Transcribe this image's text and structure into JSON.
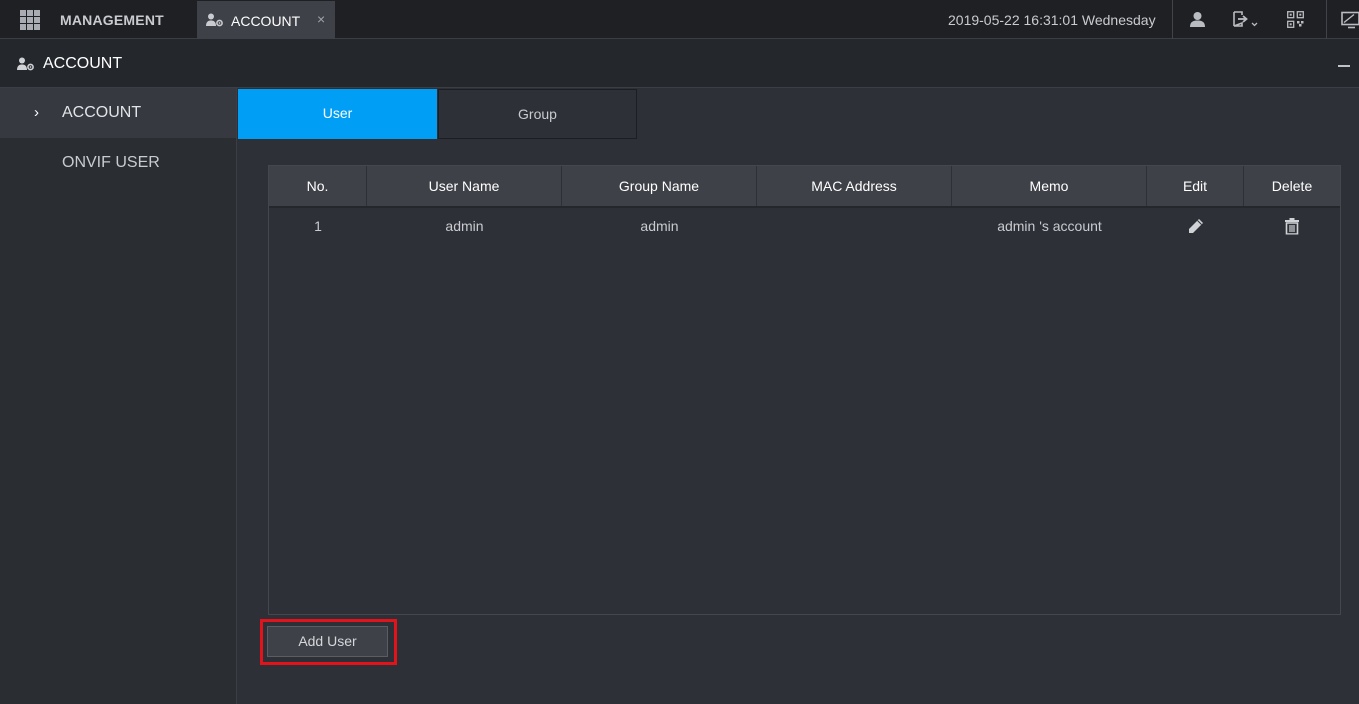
{
  "topbar": {
    "app_title": "MANAGEMENT",
    "tab_label": "ACCOUNT",
    "tab_close": "×",
    "datetime": "2019-05-22 16:31:01 Wednesday",
    "icons": [
      "apps-grid-icon",
      "user-icon",
      "logout-icon",
      "qr-code-icon",
      "monitor-icon"
    ]
  },
  "header": {
    "title": "ACCOUNT",
    "icon": "account-settings-icon"
  },
  "sidebar": {
    "items": [
      {
        "label": "ACCOUNT",
        "marker": "›",
        "active": true
      },
      {
        "label": "ONVIF USER",
        "active": false
      }
    ]
  },
  "subtabs": {
    "user": "User",
    "group": "Group"
  },
  "table": {
    "columns": [
      "No.",
      "User Name",
      "Group Name",
      "MAC Address",
      "Memo",
      "Edit",
      "Delete"
    ],
    "rows": [
      {
        "no": "1",
        "user_name": "admin",
        "group_name": "admin",
        "mac": "",
        "memo": "admin 's account"
      }
    ]
  },
  "actions": {
    "add_user": "Add User"
  },
  "colors": {
    "accent": "#009ef5",
    "highlight": "#e3131b",
    "background": "#2d3036"
  }
}
